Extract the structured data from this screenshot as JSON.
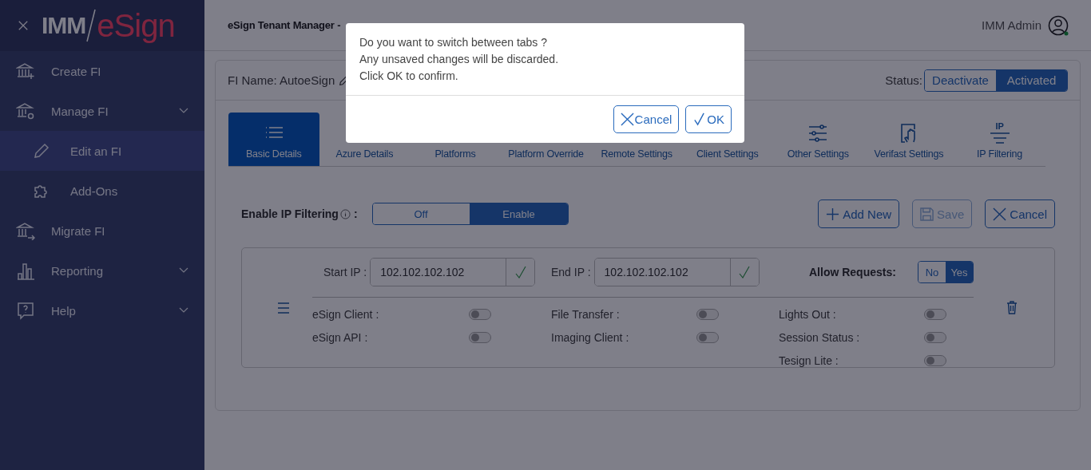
{
  "sidebar": {
    "logo": {
      "prefix": "IMM",
      "name": "eSign"
    },
    "items": [
      {
        "label": "Create FI",
        "expandable": false,
        "selected": false
      },
      {
        "label": "Manage FI",
        "expandable": true,
        "selected": false,
        "children": [
          {
            "label": "Edit an FI",
            "selected": true
          },
          {
            "label": "Add-Ons",
            "selected": false
          }
        ]
      },
      {
        "label": "Migrate FI",
        "expandable": false,
        "selected": false
      },
      {
        "label": "Reporting",
        "expandable": true,
        "selected": false
      },
      {
        "label": "Help",
        "expandable": true,
        "selected": false
      }
    ]
  },
  "header": {
    "title": "eSign Tenant Manager -",
    "user": "IMM Admin"
  },
  "fi": {
    "name_label": "FI Name: AutoeSign",
    "status_label": "Status:",
    "status_options": [
      {
        "label": "Deactivate",
        "selected": false
      },
      {
        "label": "Activated",
        "selected": true
      }
    ]
  },
  "tabs": [
    {
      "label": "Basic Details",
      "selected": true
    },
    {
      "label": "Azure Details",
      "selected": false
    },
    {
      "label": "Platforms",
      "selected": false
    },
    {
      "label": "Platform Override",
      "selected": false
    },
    {
      "label": "Remote Settings",
      "selected": false
    },
    {
      "label": "Client Settings",
      "selected": false
    },
    {
      "label": "Other Settings",
      "selected": false
    },
    {
      "label": "Verifast Settings",
      "selected": false
    },
    {
      "label": "IP Filtering",
      "selected": false,
      "icon_text": "IP"
    }
  ],
  "ip_filtering": {
    "label": "Enable IP Filtering",
    "separator": ":",
    "options": [
      {
        "label": "Off",
        "selected": false
      },
      {
        "label": "Enable",
        "selected": true
      }
    ],
    "actions": [
      {
        "label": "Add New",
        "kind": "add",
        "disabled": false
      },
      {
        "label": "Save",
        "kind": "save",
        "disabled": true
      },
      {
        "label": "Cancel",
        "kind": "cancel",
        "disabled": false
      }
    ]
  },
  "rules": [
    {
      "start_label": "Start IP :",
      "start_value": "102.102.102.102",
      "end_label": "End IP :",
      "end_value": "102.102.102.102",
      "allow_label": "Allow Requests:",
      "allow_options": [
        {
          "label": "No",
          "selected": false
        },
        {
          "label": "Yes",
          "selected": true
        }
      ],
      "service_columns": [
        {
          "items": [
            {
              "label": "eSign Client :",
              "on": false
            },
            {
              "label": "eSign API :",
              "on": false
            }
          ]
        },
        {
          "items": [
            {
              "label": "File Transfer :",
              "on": false
            },
            {
              "label": "Imaging Client :",
              "on": false
            }
          ]
        },
        {
          "items": [
            {
              "label": "Lights Out :",
              "on": false
            },
            {
              "label": "Session Status :",
              "on": false
            },
            {
              "label": "Tesign Lite :",
              "on": false
            }
          ]
        }
      ]
    }
  ],
  "dialog": {
    "lines": [
      "Do you want to switch between tabs ?",
      "Any unsaved changes will be discarded.",
      "Click OK to confirm."
    ],
    "buttons": [
      {
        "label": "Cancel",
        "kind": "cancel"
      },
      {
        "label": "OK",
        "kind": "ok"
      }
    ]
  }
}
